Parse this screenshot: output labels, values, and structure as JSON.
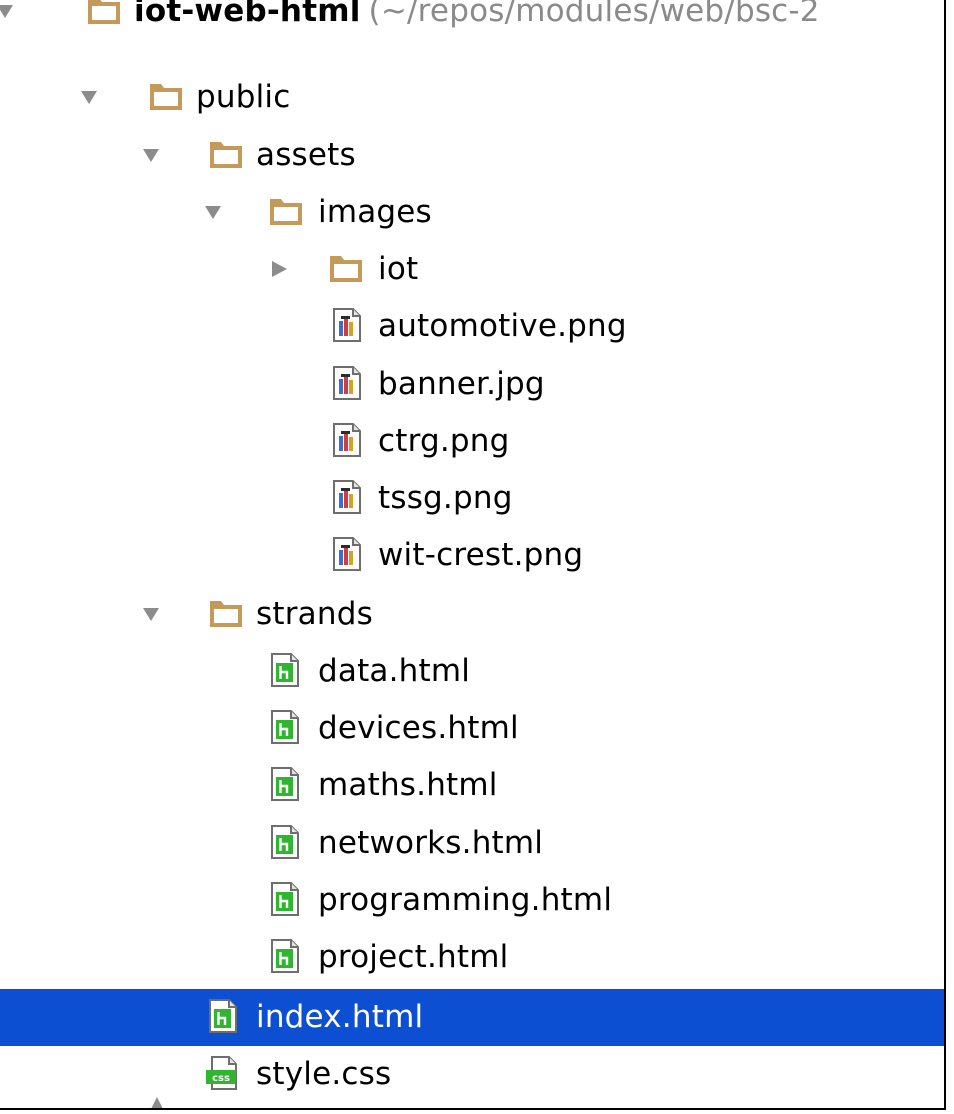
{
  "tree": {
    "root": {
      "name": "iot-web-html",
      "path": "(~/repos/modules/web/bsc-2",
      "expanded": true,
      "icon": "folder-icon"
    },
    "rows": [
      {
        "id": "public",
        "label": "public",
        "type": "folder",
        "expanded": true,
        "depth": 1
      },
      {
        "id": "assets",
        "label": "assets",
        "type": "folder",
        "expanded": true,
        "depth": 2
      },
      {
        "id": "images",
        "label": "images",
        "type": "folder",
        "expanded": true,
        "depth": 3
      },
      {
        "id": "iot",
        "label": "iot",
        "type": "folder",
        "expanded": false,
        "depth": 4
      },
      {
        "id": "automotive",
        "label": "automotive.png",
        "type": "image-file",
        "depth": 5
      },
      {
        "id": "banner",
        "label": "banner.jpg",
        "type": "image-file",
        "depth": 5
      },
      {
        "id": "ctrg",
        "label": "ctrg.png",
        "type": "image-file",
        "depth": 5
      },
      {
        "id": "tssg",
        "label": "tssg.png",
        "type": "image-file",
        "depth": 5
      },
      {
        "id": "wit-crest",
        "label": "wit-crest.png",
        "type": "image-file",
        "depth": 5
      },
      {
        "id": "strands",
        "label": "strands",
        "type": "folder",
        "expanded": true,
        "depth": 2
      },
      {
        "id": "data",
        "label": "data.html",
        "type": "html-file",
        "depth": 3
      },
      {
        "id": "devices",
        "label": "devices.html",
        "type": "html-file",
        "depth": 3
      },
      {
        "id": "maths",
        "label": "maths.html",
        "type": "html-file",
        "depth": 3
      },
      {
        "id": "networks",
        "label": "networks.html",
        "type": "html-file",
        "depth": 3
      },
      {
        "id": "programming",
        "label": "programming.html",
        "type": "html-file",
        "depth": 3
      },
      {
        "id": "project",
        "label": "project.html",
        "type": "html-file",
        "depth": 3
      },
      {
        "id": "index",
        "label": "index.html",
        "type": "html-file",
        "depth": 2,
        "selected": true
      },
      {
        "id": "style",
        "label": "style.css",
        "type": "css-file",
        "depth": 2
      }
    ]
  },
  "colors": {
    "selection": "#0d4fd2",
    "folder": "#c49a5a",
    "html_icon": "#2fb52f",
    "path_text": "#8a8a8a",
    "arrow": "#8c8c8c"
  }
}
